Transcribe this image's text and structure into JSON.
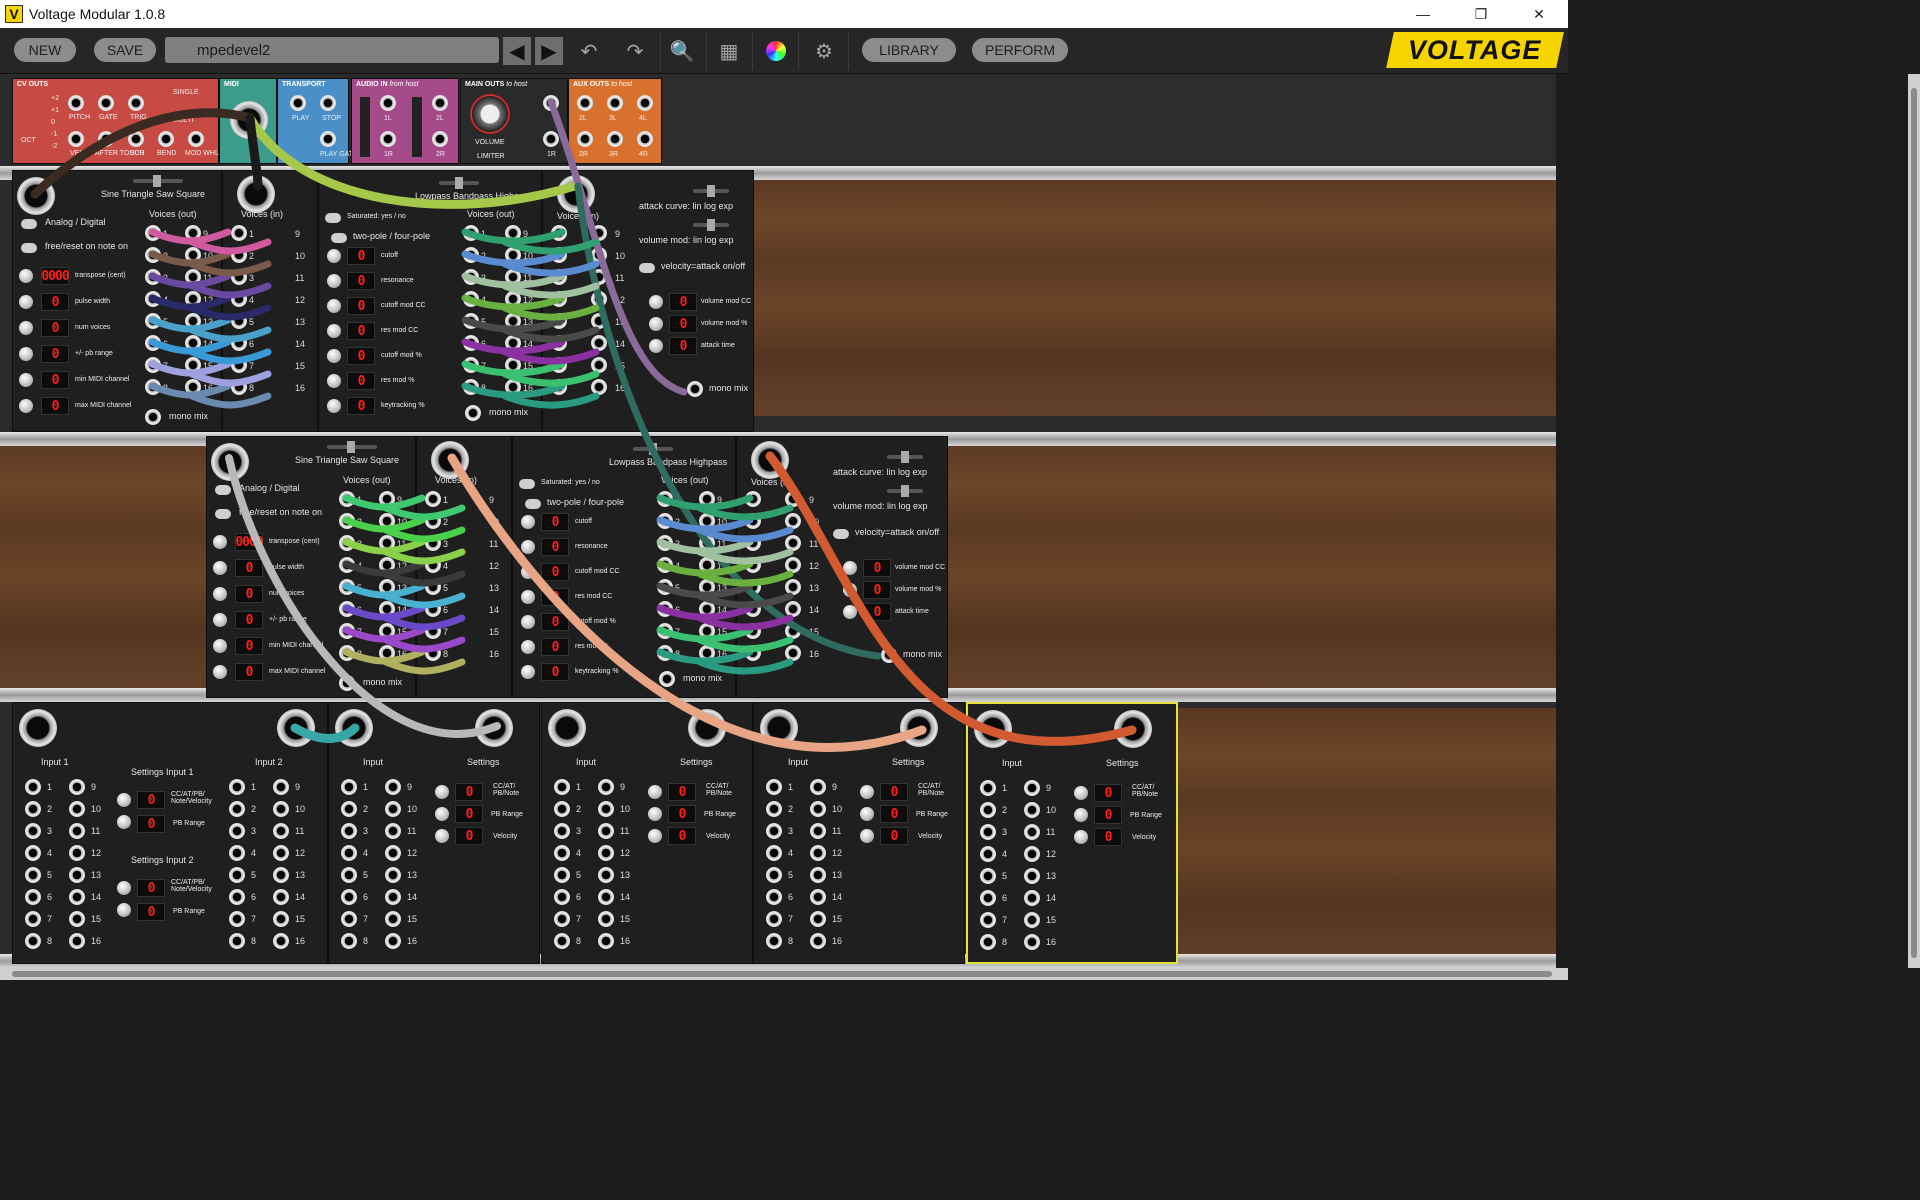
{
  "window": {
    "title": "Voltage Modular 1.0.8",
    "app_icon": "V",
    "minimize": "—",
    "restore": "❐",
    "close": "✕"
  },
  "toolbar": {
    "new_label": "NEW",
    "save_label": "SAVE",
    "preset_name": "mpedevel2",
    "library_label": "LIBRARY",
    "perform_label": "PERFORM",
    "logo": "VOLTAGE"
  },
  "host_modules": {
    "cv_outs": {
      "title": "CV OUTS",
      "octave": "OCT",
      "single": "SINGLE",
      "multi": "MULTI",
      "jacks": [
        "PITCH",
        "GATE",
        "TRIG",
        "VEL",
        "AFTER TOUCH",
        "SUS",
        "BEND",
        "MOD WHL"
      ],
      "octave_levels": [
        "+2",
        "+1",
        "0",
        "-1",
        "-2"
      ]
    },
    "midi": {
      "title": "MIDI"
    },
    "transport": {
      "title": "TRANSPORT",
      "jacks": [
        "PLAY",
        "STOP",
        "PLAY GATE"
      ]
    },
    "audio_in": {
      "title": "AUDIO IN",
      "subtitle": "from host",
      "jacks": [
        "1L",
        "1R",
        "2L",
        "2R"
      ]
    },
    "main_outs": {
      "title": "MAIN OUTS",
      "subtitle": "to host",
      "volume": "VOLUME",
      "limiter": "LIMITER",
      "jacks": [
        "1R"
      ]
    },
    "aux_outs": {
      "title": "AUX OUTS",
      "subtitle": "to host",
      "jacks": [
        "2L",
        "3L",
        "4L",
        "2R",
        "3R",
        "4R"
      ]
    }
  },
  "poly_osc": {
    "wave_label": "Sine Triangle Saw Square",
    "analog_digital": "Analog / Digital",
    "free_reset": "free/reset on note on",
    "voices_out": "Voices (out)",
    "voices_in": "Voices (in)",
    "mono_mix": "mono mix",
    "params": [
      "transpose (cent)",
      "pulse width",
      "num voices",
      "+/- pb range",
      "min MIDI channel",
      "max MIDI channel"
    ],
    "led_values": [
      "0000",
      "0",
      "0",
      "0",
      "0",
      "0"
    ]
  },
  "poly_filter": {
    "mode_label": "Lowpass Bandpass Highpass",
    "saturated": "Saturated: yes / no",
    "pole": "two-pole / four-pole",
    "voices_out": "Voices (out)",
    "mono_mix": "mono mix",
    "params": [
      "cutoff",
      "resonance",
      "cutoff mod CC",
      "res mod CC",
      "cutoff mod %",
      "res mod %",
      "keytracking %"
    ],
    "led_values": [
      "0",
      "0",
      "0",
      "0",
      "0",
      "0",
      "0"
    ]
  },
  "poly_vca": {
    "voices_in": "Voices (in)",
    "attack_curve": "attack curve: lin log exp",
    "volume_mod": "volume mod: lin log exp",
    "velocity_attack": "velocity=attack on/off",
    "params": [
      "volume mod CC",
      "volume mod %",
      "attack time"
    ],
    "led_values": [
      "0",
      "0",
      "0"
    ],
    "mono_mix": "mono mix"
  },
  "voice_numbers_left": [
    "1",
    "2",
    "3",
    "4",
    "5",
    "6",
    "7",
    "8"
  ],
  "voice_numbers_right": [
    "9",
    "10",
    "11",
    "12",
    "13",
    "14",
    "15",
    "16"
  ],
  "mpe_modules": {
    "input1": "Input 1",
    "input2": "Input 2",
    "input": "Input",
    "settings": "Settings",
    "settings_input1": "Settings Input 1",
    "settings_input2": "Settings Input 2",
    "cc_at": "CC/AT/PB/ Note/Velocity",
    "cc_at_short": "CC/AT/ PB/Note",
    "pb_range": "PB Range",
    "velocity": "Velocity",
    "led": "0"
  },
  "colors": {
    "accent_yellow": "#f6d400",
    "led_red": "#ff1e1e",
    "cv_outs": "#c74a44",
    "midi": "#3d9b8b",
    "transport": "#4a8fc8",
    "audio_in": "#a54b8a",
    "aux_outs": "#d8712e",
    "selection": "#e3e23a"
  }
}
